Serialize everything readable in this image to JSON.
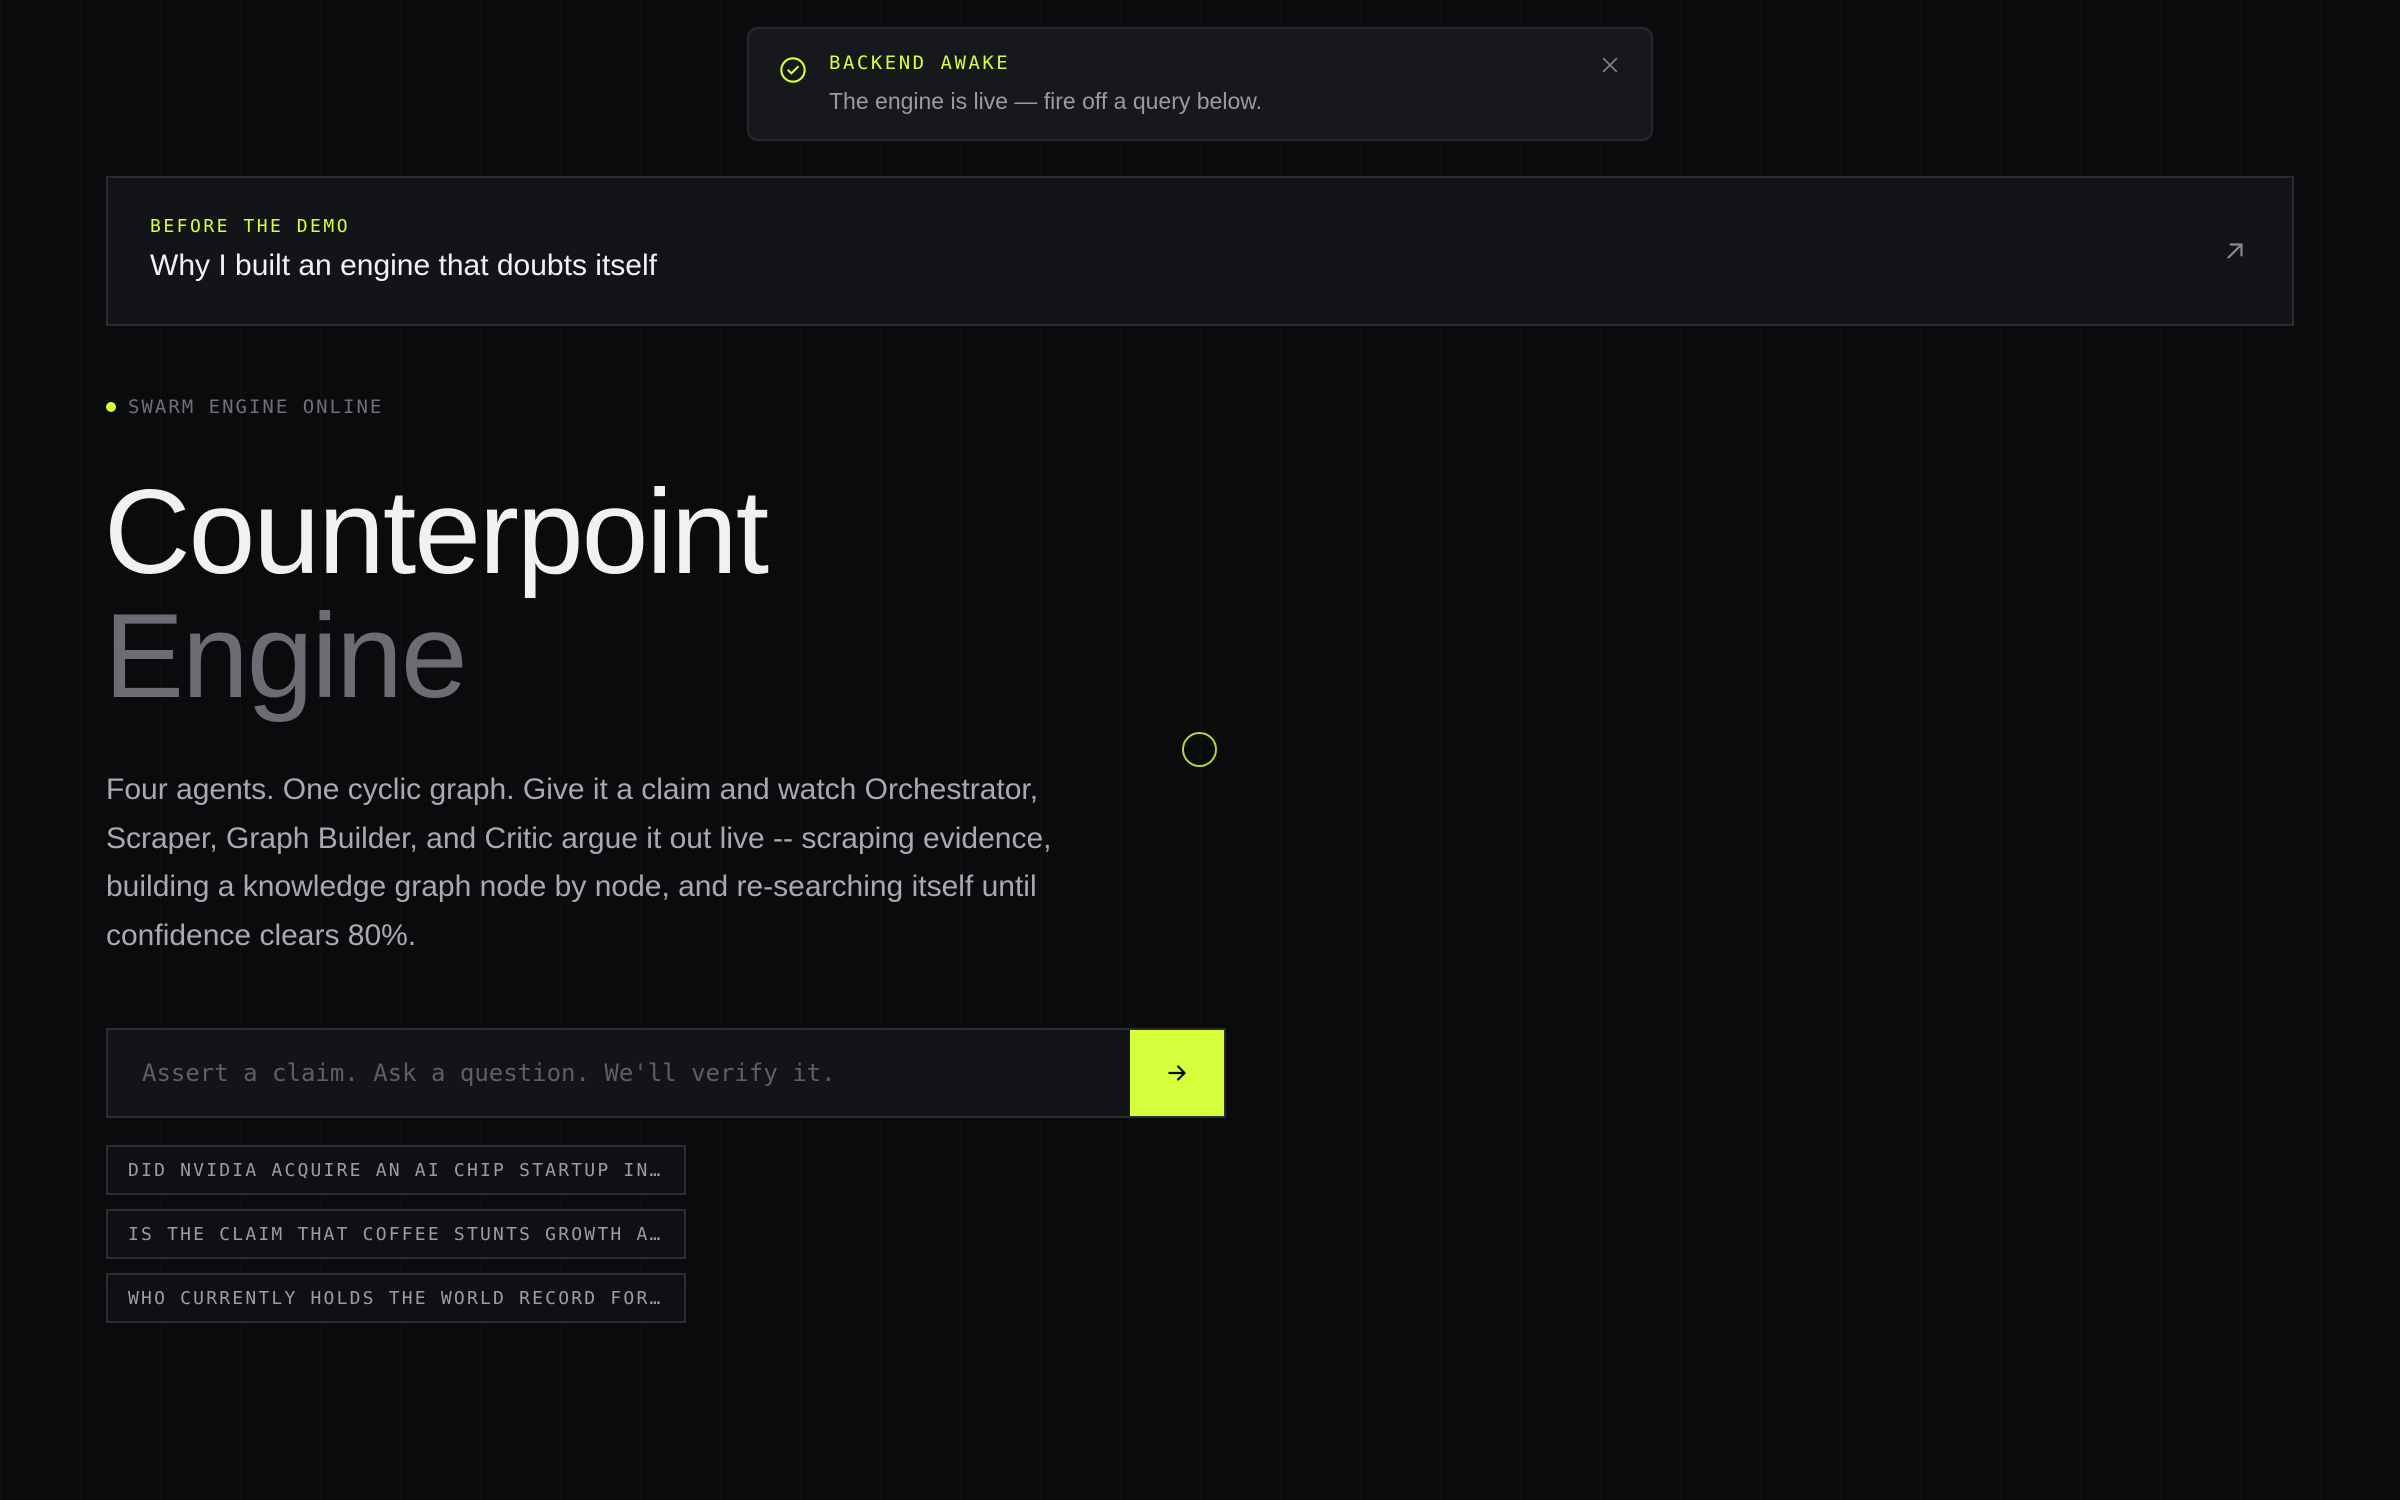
{
  "toast": {
    "title": "BACKEND AWAKE",
    "message": "The engine is live — fire off a query below.",
    "icon": "check-circle-icon",
    "close_icon": "close-icon"
  },
  "demo_card": {
    "eyebrow": "BEFORE THE DEMO",
    "title": "Why I built an engine that doubts itself",
    "icon": "arrow-up-right-icon"
  },
  "status": {
    "label": "SWARM ENGINE ONLINE"
  },
  "hero": {
    "title_line1": "Counterpoint",
    "title_line2": "Engine",
    "description": "Four agents. One cyclic graph. Give it a claim and watch Orchestrator, Scraper, Graph Builder, and Critic argue it out live -- scraping evidence, building a knowledge graph node by node, and re-searching itself until confidence clears 80%."
  },
  "search": {
    "placeholder": "Assert a claim. Ask a question. We'll verify it.",
    "value": "",
    "submit_icon": "arrow-right-icon"
  },
  "suggestions": [
    "DID NVIDIA ACQUIRE AN AI CHIP STARTUP IN T…",
    "IS THE CLAIM THAT COFFEE STUNTS GROWTH ACT…",
    "WHO CURRENTLY HOLDS THE WORLD RECORD FOR T…"
  ],
  "colors": {
    "accent": "#d4ff3a",
    "background": "#0a0b0d",
    "panel": "#131418",
    "muted_text": "#a9aab0"
  }
}
